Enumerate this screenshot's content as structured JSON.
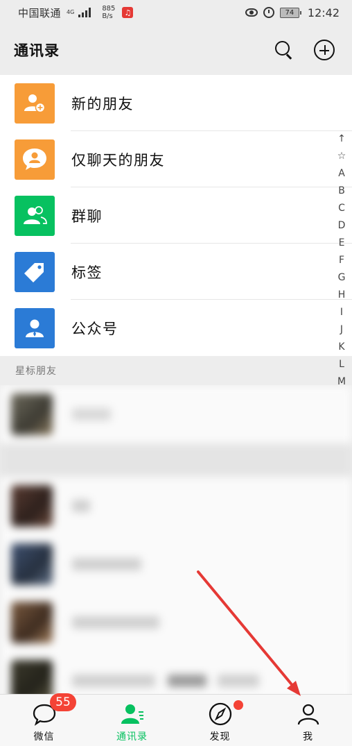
{
  "status_bar": {
    "carrier": "中国联通",
    "network": "4G",
    "speed_value": "885",
    "speed_unit": "B/s",
    "battery": "74",
    "time": "12:42"
  },
  "header": {
    "title": "通讯录",
    "search_icon": "search-icon",
    "add_icon": "add-circle-icon"
  },
  "functions": [
    {
      "label": "新的朋友",
      "color": "#f79c38",
      "icon": "add-friend-icon"
    },
    {
      "label": "仅聊天的朋友",
      "color": "#f79c38",
      "icon": "chat-friend-icon"
    },
    {
      "label": "群聊",
      "color": "#07c160",
      "icon": "group-chat-icon"
    },
    {
      "label": "标签",
      "color": "#2b7bd6",
      "icon": "tag-icon"
    },
    {
      "label": "公众号",
      "color": "#2b7bd6",
      "icon": "official-account-icon"
    }
  ],
  "section": {
    "starred_title": "星标朋友"
  },
  "index_letters": [
    "↑",
    "☆",
    "A",
    "B",
    "C",
    "D",
    "E",
    "F",
    "G",
    "H",
    "I",
    "J",
    "K",
    "L",
    "M"
  ],
  "tabs": [
    {
      "label": "微信",
      "icon": "chat-bubble-icon",
      "badge": "55",
      "active": false
    },
    {
      "label": "通讯录",
      "icon": "contacts-icon",
      "active": true
    },
    {
      "label": "发现",
      "icon": "compass-icon",
      "active": false
    },
    {
      "label": "我",
      "icon": "profile-icon",
      "active": false
    }
  ],
  "colors": {
    "accent_green": "#07c160",
    "badge_red": "#f44336",
    "annotation_red": "#e53935"
  }
}
